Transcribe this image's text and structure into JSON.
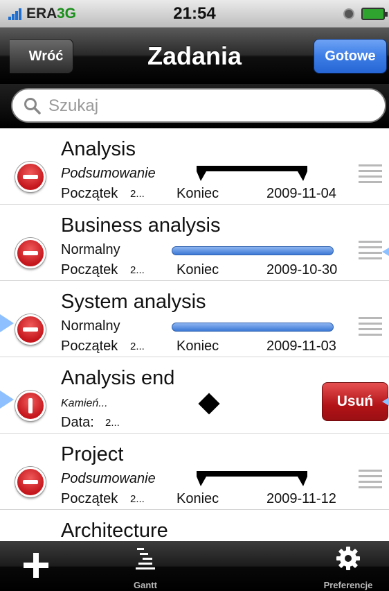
{
  "status_bar": {
    "carrier": "ERA",
    "network": "3G",
    "time": "21:54",
    "icons": [
      "signal-icon",
      "clock-icon",
      "battery-charging-icon"
    ]
  },
  "nav_bar": {
    "back_label": "Wróć",
    "title": "Zadania",
    "done_label": "Gotowe"
  },
  "search": {
    "placeholder": "Szukaj",
    "value": ""
  },
  "tasks": [
    {
      "name": "Analysis",
      "type": "Podsumowanie",
      "start_label": "Początek",
      "start_value": "2...",
      "end_label": "Koniec",
      "end_value": "2009-11-04",
      "bar": "summary"
    },
    {
      "name": "Business analysis",
      "type": "Normalny",
      "start_label": "Początek",
      "start_value": "2...",
      "end_label": "Koniec",
      "end_value": "2009-10-30",
      "bar": "normal"
    },
    {
      "name": "System analysis",
      "type": "Normalny",
      "start_label": "Początek",
      "start_value": "2...",
      "end_label": "Koniec",
      "end_value": "2009-11-03",
      "bar": "normal"
    },
    {
      "name": "Analysis end",
      "type": "Kamień...",
      "date_label": "Data:",
      "date_value": "2...",
      "bar": "milestone",
      "delete_label": "Usuń"
    },
    {
      "name": "Project",
      "type": "Podsumowanie",
      "start_label": "Początek",
      "start_value": "2...",
      "end_label": "Koniec",
      "end_value": "2009-11-12",
      "bar": "summary"
    },
    {
      "name": "Architecture"
    }
  ],
  "toolbar": {
    "add_icon": "plus-icon",
    "gantt_label": "Gantt",
    "preferences_label": "Preferencje"
  },
  "colors": {
    "nav_dark": "#000000",
    "done_blue": "#2f6fe0",
    "delete_red": "#c4161c",
    "bar_blue": "#3d79d6"
  }
}
